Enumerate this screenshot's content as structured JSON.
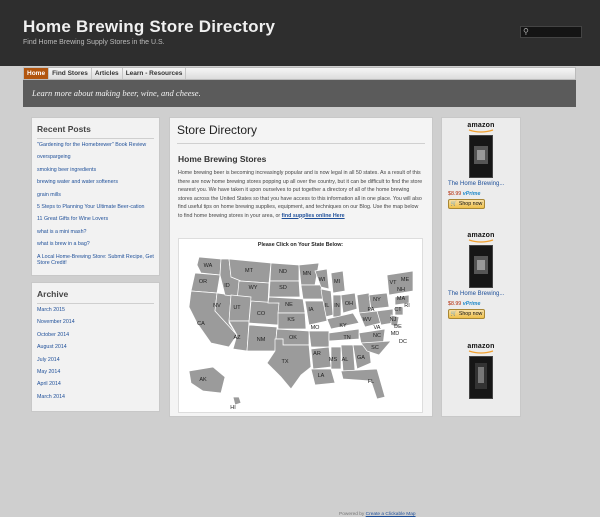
{
  "header": {
    "title": "Home Brewing Store Directory",
    "description": "Find Home Brewing Supply Stores in the U.S."
  },
  "search": {
    "icon": "search-icon"
  },
  "nav": {
    "items": [
      {
        "label": "Home",
        "active": true
      },
      {
        "label": "Find Stores",
        "active": false
      },
      {
        "label": "Articles",
        "active": false
      },
      {
        "label": "Learn - Resources",
        "active": false
      }
    ]
  },
  "tagline": "Learn more about making beer, wine, and cheese.",
  "sidebar": {
    "recent_posts_title": "Recent Posts",
    "recent_posts": [
      "\"Gardening for the Homebrewer\" Book Review",
      "overspargeing",
      "smoking beer ingredients",
      "brewing water and water softeners",
      "grain mills",
      "5 Steps to Planning Your Ultimate Beer-cation",
      "11 Great Gifts for Wine Lovers",
      "what is a mini mash?",
      "what is brew in a bag?",
      "A Local Home-Brewing Store: Submit Recipe, Get Store Credit!"
    ],
    "archive_title": "Archive",
    "archive": [
      "March 2015",
      "November 2014",
      "October 2014",
      "August 2014",
      "July 2014",
      "May 2014",
      "April 2014",
      "March 2014"
    ]
  },
  "content": {
    "page_title": "Store Directory",
    "section_heading": "Home Brewing Stores",
    "intro_text": "Home brewing beer is becoming increasingly popular and is now legal in all 50 states. As a result of this there are now home brewing stores popping up all over the country, but it can be difficult to find the store nearest you. We have taken it upon ourselves to put together a directory of all of the home brewing stores across the United States so that you have access to this information all in one place. You will also find useful tips on home brewing supplies, equipment, and techniques on our Blog. Use the map below to find home brewing stores in your area, or ",
    "intro_link": "find supplies online Here",
    "map_caption": "Please Click on Your State Below:",
    "powered_by": "Powered by ",
    "powered_link": "Create a Clickable Map",
    "states": [
      "WA",
      "OR",
      "ID",
      "MT",
      "ND",
      "MN",
      "SD",
      "WI",
      "MI",
      "NY",
      "VT",
      "ME",
      "NH",
      "MA",
      "RI",
      "CT",
      "NJ",
      "DE",
      "MD",
      "DC",
      "WY",
      "NE",
      "IA",
      "IL",
      "IN",
      "OH",
      "PA",
      "WV",
      "VA",
      "NV",
      "UT",
      "CO",
      "KS",
      "MO",
      "KY",
      "CA",
      "AZ",
      "NM",
      "OK",
      "AR",
      "TN",
      "NC",
      "SC",
      "MS",
      "AL",
      "GA",
      "TX",
      "LA",
      "FL",
      "AK",
      "HI"
    ]
  },
  "ads": [
    {
      "logo": "amazon",
      "title": "The Home Brewing...",
      "price": "$8.99",
      "prime": "vPrime",
      "shop": "Shop now"
    },
    {
      "logo": "amazon",
      "title": "The Home Brewing...",
      "price": "$8.99",
      "prime": "vPrime",
      "shop": "Shop now"
    },
    {
      "logo": "amazon"
    }
  ],
  "colors": {
    "header_bg": "#2e2e2e",
    "nav_active": "#b2560f",
    "banner_bg": "#5b5b5b",
    "link": "#1e4f99",
    "map_state": "#9b9b9b"
  }
}
